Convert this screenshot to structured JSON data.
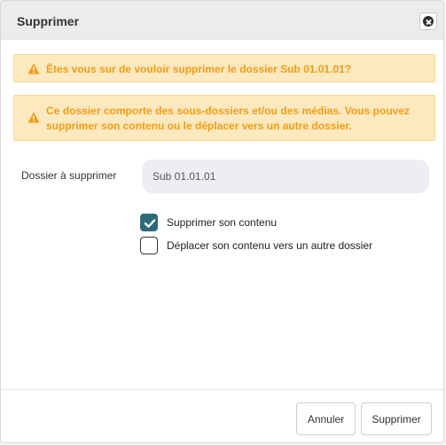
{
  "dialog": {
    "title": "Supprimer",
    "close_icon": "close-circle-icon"
  },
  "alerts": [
    {
      "icon": "warning-icon",
      "text": "Êtes vous sur de vouloir supprimer le dossier Sub 01.01.01?"
    },
    {
      "icon": "warning-icon",
      "text": "Ce dossier comporte des sous-dossiers et/ou des médias. Vous pouvez supprimer son contenu ou le déplacer vers un autre dossier."
    }
  ],
  "form": {
    "folder_label": "Dossier à supprimer",
    "folder_value": "Sub 01.01.01"
  },
  "options": [
    {
      "label": "Supprimer son contenu",
      "checked": true
    },
    {
      "label": "Déplacer son contenu vers un autre dossier",
      "checked": false
    }
  ],
  "footer": {
    "cancel_label": "Annuler",
    "delete_label": "Supprimer"
  },
  "colors": {
    "alert_bg": "#fde9c0",
    "alert_text": "#f39c12",
    "checkbox_checked": "#2e6b78",
    "header_bg": "#ececec"
  }
}
